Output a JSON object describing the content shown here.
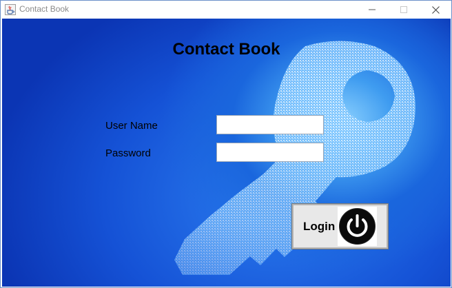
{
  "window": {
    "title": "Contact Book",
    "app_icon": "java-cup-icon",
    "controls": [
      "minimize-icon",
      "maximize-icon",
      "close-icon"
    ]
  },
  "form": {
    "heading": "Contact Book",
    "username_label": "User Name",
    "username_value": "",
    "password_label": "Password",
    "password_value": "",
    "login_label": "Login",
    "login_icon": "power-icon"
  },
  "colors": {
    "background_blue": "#1552d6",
    "glow": "#8fd3ff"
  }
}
